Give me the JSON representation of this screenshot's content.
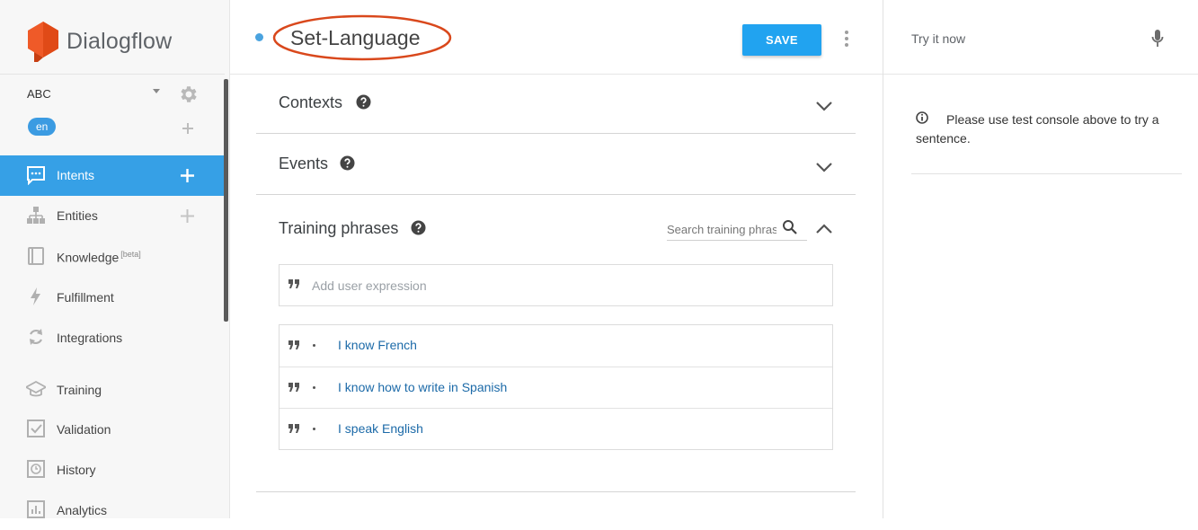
{
  "brand": {
    "name": "Dialogflow"
  },
  "agent": {
    "name": "ABC",
    "language": "en"
  },
  "sidebar": {
    "items": [
      {
        "label": "Intents",
        "icon": "chat-bubble-icon",
        "active": true
      },
      {
        "label": "Entities",
        "icon": "hierarchy-icon"
      },
      {
        "label": "Knowledge",
        "badge": "[beta]",
        "icon": "book-icon"
      },
      {
        "label": "Fulfillment",
        "icon": "bolt-icon"
      },
      {
        "label": "Integrations",
        "icon": "refresh-icon"
      },
      {
        "label": "Training",
        "icon": "graduation-cap-icon"
      },
      {
        "label": "Validation",
        "icon": "checkbox-icon"
      },
      {
        "label": "History",
        "icon": "clock-icon"
      },
      {
        "label": "Analytics",
        "icon": "bar-chart-icon"
      }
    ]
  },
  "header": {
    "intent_name": "Set-Language",
    "save_label": "SAVE"
  },
  "main": {
    "contexts_title": "Contexts",
    "events_title": "Events",
    "training_title": "Training phrases",
    "search_placeholder": "Search training phrases",
    "expression_placeholder": "Add user expression",
    "phrases": [
      "I know French",
      "I know how to write in Spanish",
      "I speak English"
    ]
  },
  "right_panel": {
    "try_label": "Try it now",
    "info_message": "Please use test console above to try a sentence."
  },
  "colors": {
    "accent": "#36a0e6",
    "save": "#21a3f0",
    "logo": "#ef5a28",
    "annotation": "#d9481c"
  }
}
